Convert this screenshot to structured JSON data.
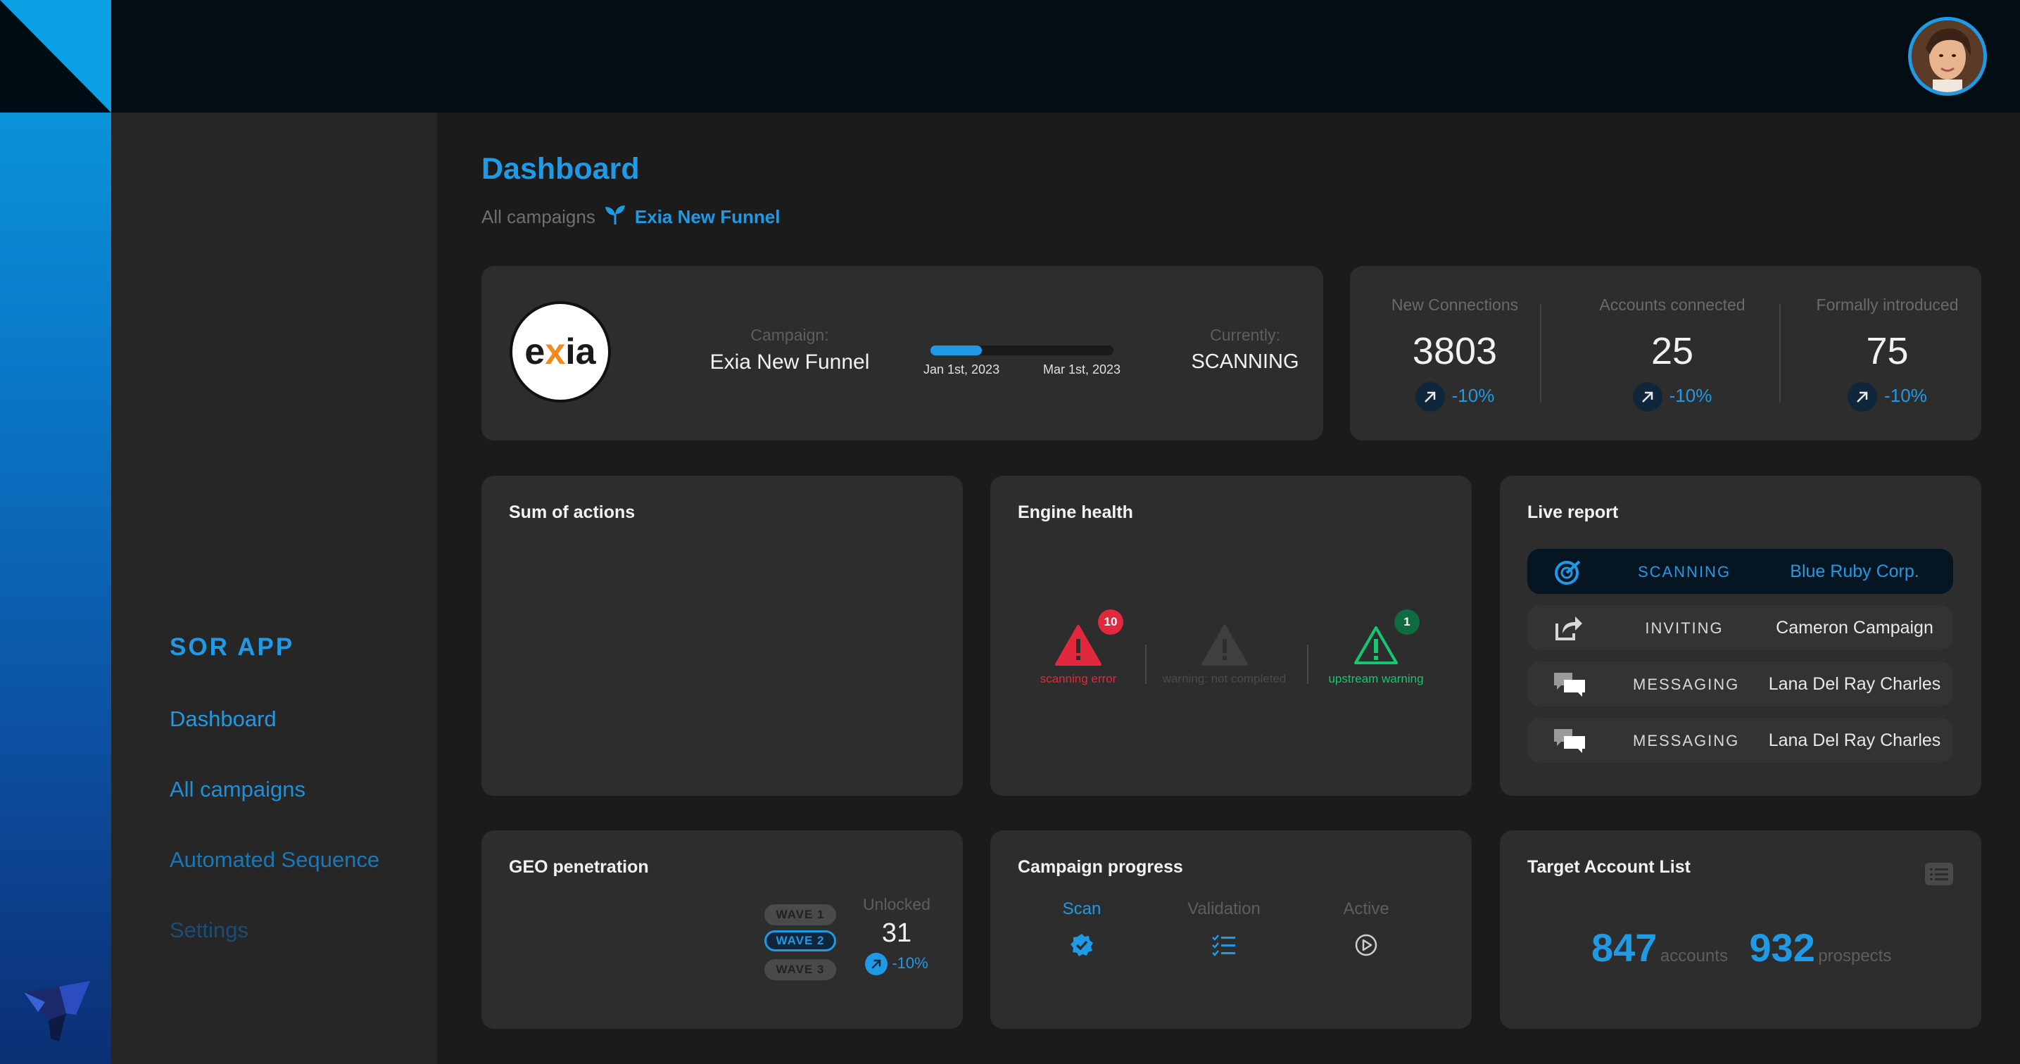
{
  "colors": {
    "accent": "#1e9ae6",
    "error": "#e2283d",
    "success": "#12c970",
    "panel": "#2d2d2d",
    "background": "#1b1b1b"
  },
  "sidebar": {
    "app_title": "SOR APP",
    "items": [
      {
        "label": "Dashboard"
      },
      {
        "label": "All campaigns"
      },
      {
        "label": "Automated Sequence"
      },
      {
        "label": "Settings"
      }
    ],
    "logo_icon": "bird-logo-icon"
  },
  "header": {
    "avatar": "user-avatar"
  },
  "page": {
    "title": "Dashboard",
    "breadcrumb": {
      "root": "All campaigns",
      "separator_icon": "sprout-icon",
      "current": "Exia New Funnel"
    }
  },
  "campaign": {
    "logo_text": "exia",
    "campaign_label": "Campaign:",
    "campaign_name": "Exia New Funnel",
    "timeline": {
      "start": "Jan 1st, 2023",
      "end": "Mar 1st, 2023",
      "progress": 0.28
    },
    "currently_label": "Currently:",
    "currently_value": "SCANNING"
  },
  "stats": [
    {
      "label": "New Connections",
      "value": "3803",
      "delta": "-10%"
    },
    {
      "label": "Accounts connected",
      "value": "25",
      "delta": "-10%"
    },
    {
      "label": "Formally introduced",
      "value": "75",
      "delta": "-10%"
    }
  ],
  "sum_of_actions": {
    "title": "Sum of actions"
  },
  "engine_health": {
    "title": "Engine health",
    "items": [
      {
        "label": "scanning error",
        "count": "10",
        "color": "#e2283d",
        "icon": "warning-triangle-icon"
      },
      {
        "label": "warning: not completed",
        "count": "",
        "color": "#4a4a4a",
        "icon": "warning-triangle-icon"
      },
      {
        "label": "upstream warning",
        "count": "1",
        "color": "#12c970",
        "icon": "warning-triangle-icon"
      }
    ]
  },
  "live_report": {
    "title": "Live report",
    "rows": [
      {
        "status": "SCANNING",
        "name": "Blue Ruby Corp.",
        "icon": "radar-icon"
      },
      {
        "status": "INVITING",
        "name": "Cameron Campaign",
        "icon": "share-icon"
      },
      {
        "status": "MESSAGING",
        "name": "Lana Del Ray Charles",
        "icon": "chat-icon"
      },
      {
        "status": "MESSAGING",
        "name": "Lana Del Ray Charles",
        "icon": "chat-icon"
      }
    ]
  },
  "geo": {
    "title": "GEO penetration",
    "waves": [
      "WAVE 1",
      "WAVE 2",
      "WAVE 3"
    ],
    "active_wave": "WAVE 2",
    "unlocked_label": "Unlocked",
    "unlocked_value": "31",
    "delta": "-10%"
  },
  "campaign_progress": {
    "title": "Campaign progress",
    "steps": [
      {
        "label": "Scan",
        "icon": "check-badge-icon"
      },
      {
        "label": "Validation",
        "icon": "checklist-icon"
      },
      {
        "label": "Active",
        "icon": "play-circle-icon"
      }
    ],
    "active_step": "Scan"
  },
  "target_list": {
    "title": "Target Account List",
    "accounts_value": "847",
    "accounts_label": "accounts",
    "prospects_value": "932",
    "prospects_label": "prospects",
    "menu_icon": "list-icon"
  }
}
